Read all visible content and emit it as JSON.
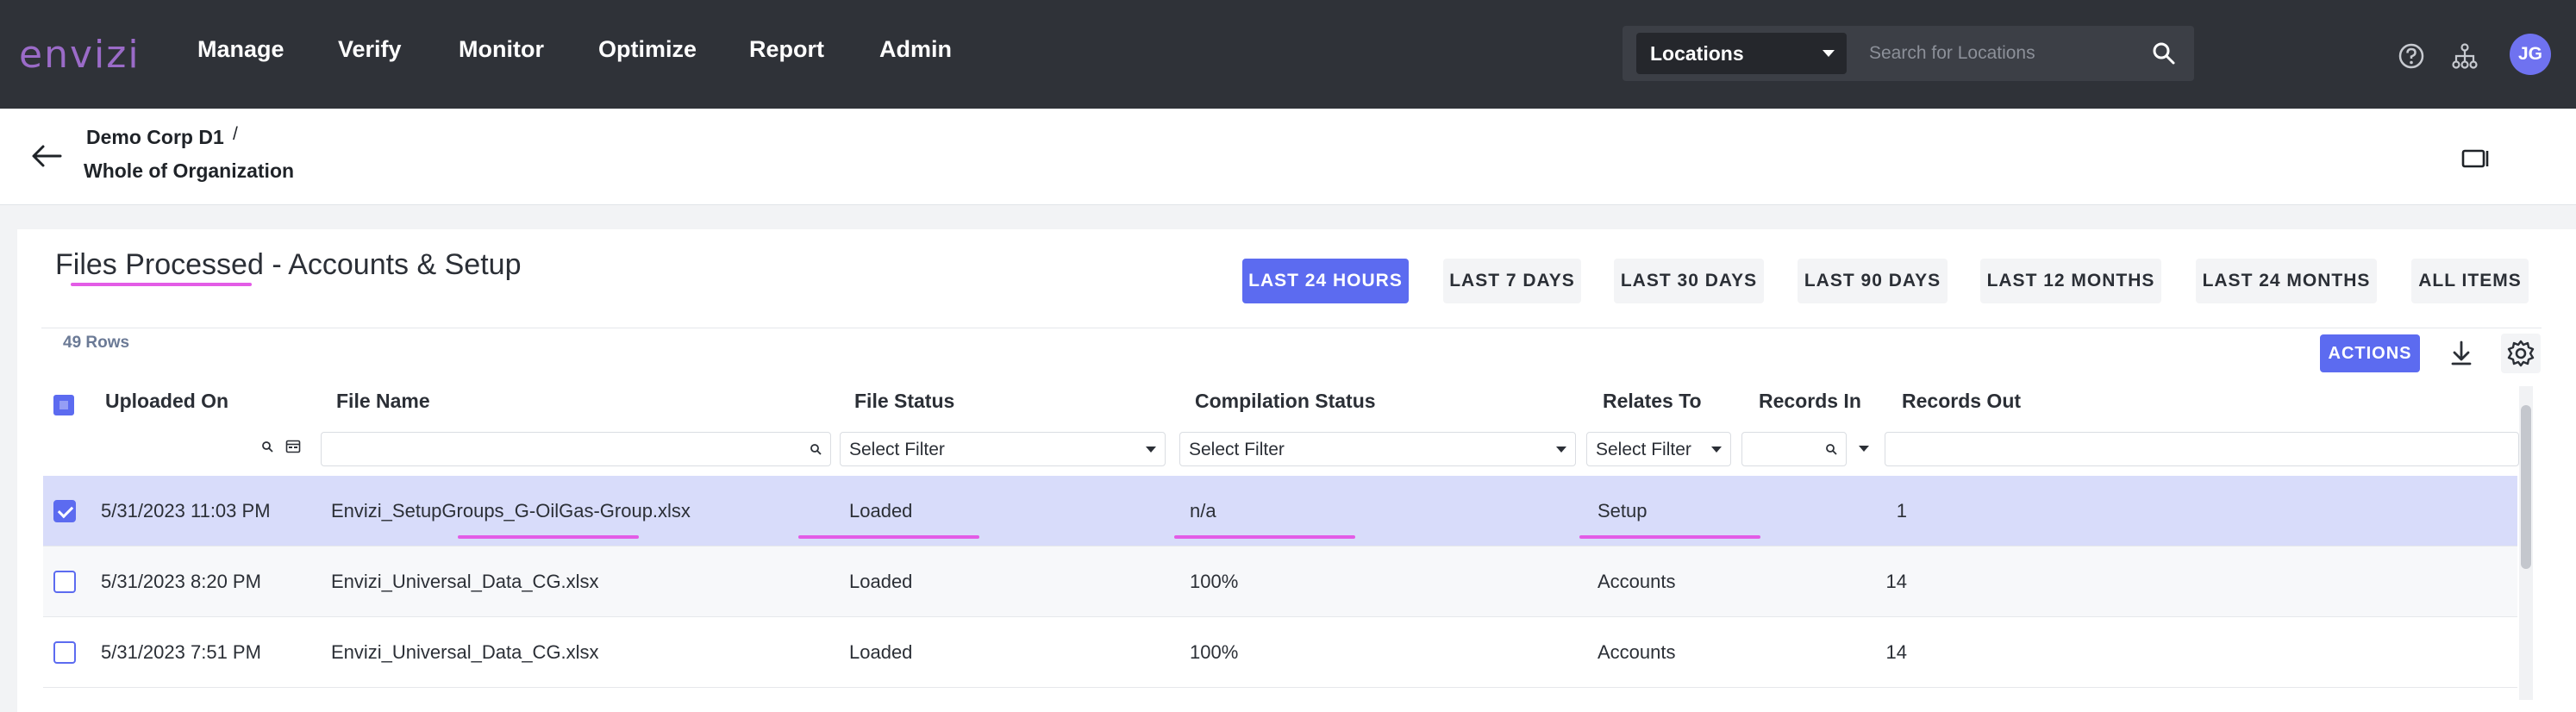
{
  "app": {
    "logo": "envizi"
  },
  "nav": {
    "items": [
      "Manage",
      "Verify",
      "Monitor",
      "Optimize",
      "Report",
      "Admin"
    ]
  },
  "search": {
    "scope": "Locations",
    "placeholder": "Search for Locations"
  },
  "user": {
    "initials": "JG"
  },
  "breadcrumb": {
    "parent": "Demo Corp D1",
    "separator": "/",
    "current": "Whole of Organization"
  },
  "page": {
    "title": "Files Processed - Accounts & Setup",
    "rows_count": "49 Rows",
    "actions_label": "ACTIONS"
  },
  "time_ranges": [
    "LAST 24 HOURS",
    "LAST 7 DAYS",
    "LAST 30 DAYS",
    "LAST 90 DAYS",
    "LAST 12 MONTHS",
    "LAST 24 MONTHS",
    "ALL ITEMS"
  ],
  "active_range": "LAST 24 HOURS",
  "table": {
    "headers": {
      "uploaded_on": "Uploaded On",
      "file_name": "File Name",
      "file_status": "File Status",
      "compilation_status": "Compilation Status",
      "relates_to": "Relates To",
      "records_in": "Records In",
      "records_out": "Records Out"
    },
    "filters": {
      "file_status": "Select Filter",
      "compilation_status": "Select Filter",
      "relates_to": "Select Filter"
    },
    "rows": [
      {
        "selected": true,
        "uploaded_on": "5/31/2023 11:03 PM",
        "file_name": "Envizi_SetupGroups_G-OilGas-Group.xlsx",
        "file_status": "Loaded",
        "compilation_status": "n/a",
        "relates_to": "Setup",
        "records_in": "1",
        "records_out": ""
      },
      {
        "selected": false,
        "uploaded_on": "5/31/2023 8:20 PM",
        "file_name": "Envizi_Universal_Data_CG.xlsx",
        "file_status": "Loaded",
        "compilation_status": "100%",
        "relates_to": "Accounts",
        "records_in": "14",
        "records_out": ""
      },
      {
        "selected": false,
        "uploaded_on": "5/31/2023 7:51 PM",
        "file_name": "Envizi_Universal_Data_CG.xlsx",
        "file_status": "Loaded",
        "compilation_status": "100%",
        "relates_to": "Accounts",
        "records_in": "14",
        "records_out": ""
      }
    ]
  },
  "colors": {
    "topbar": "#2f3238",
    "accent": "#5c6bf0",
    "highlight": "#e35ce6",
    "selected_row": "#d8dcfa"
  }
}
